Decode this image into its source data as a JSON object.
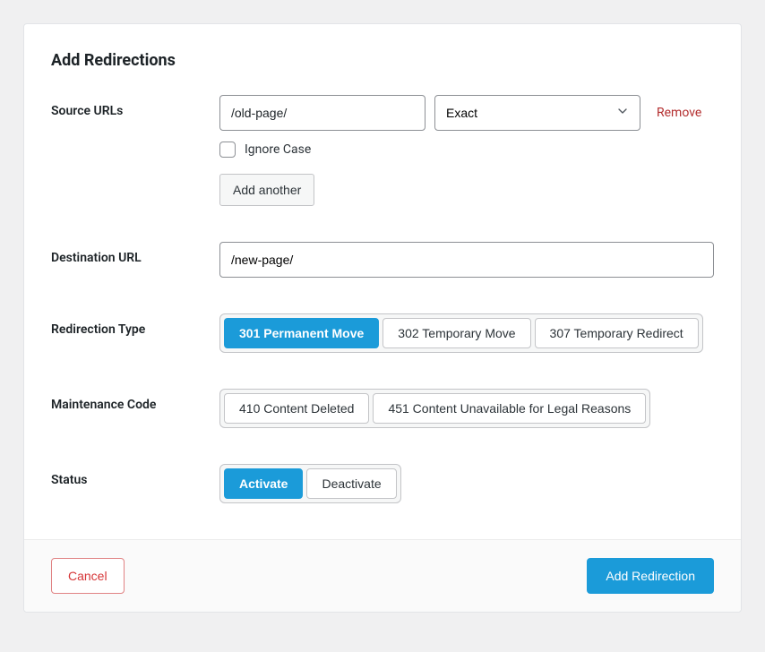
{
  "panel": {
    "title": "Add Redirections"
  },
  "source": {
    "label": "Source URLs",
    "url_value": "/old-page/",
    "match_type_selected": "Exact",
    "remove_label": "Remove",
    "ignore_case_label": "Ignore Case",
    "add_another_label": "Add another"
  },
  "destination": {
    "label": "Destination URL",
    "value": "/new-page/"
  },
  "redirection_type": {
    "label": "Redirection Type",
    "options": [
      {
        "label": "301 Permanent Move",
        "active": true
      },
      {
        "label": "302 Temporary Move",
        "active": false
      },
      {
        "label": "307 Temporary Redirect",
        "active": false
      }
    ]
  },
  "maintenance_code": {
    "label": "Maintenance Code",
    "options": [
      {
        "label": "410 Content Deleted",
        "active": false
      },
      {
        "label": "451 Content Unavailable for Legal Reasons",
        "active": false
      }
    ]
  },
  "status": {
    "label": "Status",
    "options": [
      {
        "label": "Activate",
        "active": true
      },
      {
        "label": "Deactivate",
        "active": false
      }
    ]
  },
  "footer": {
    "cancel_label": "Cancel",
    "submit_label": "Add Redirection"
  }
}
